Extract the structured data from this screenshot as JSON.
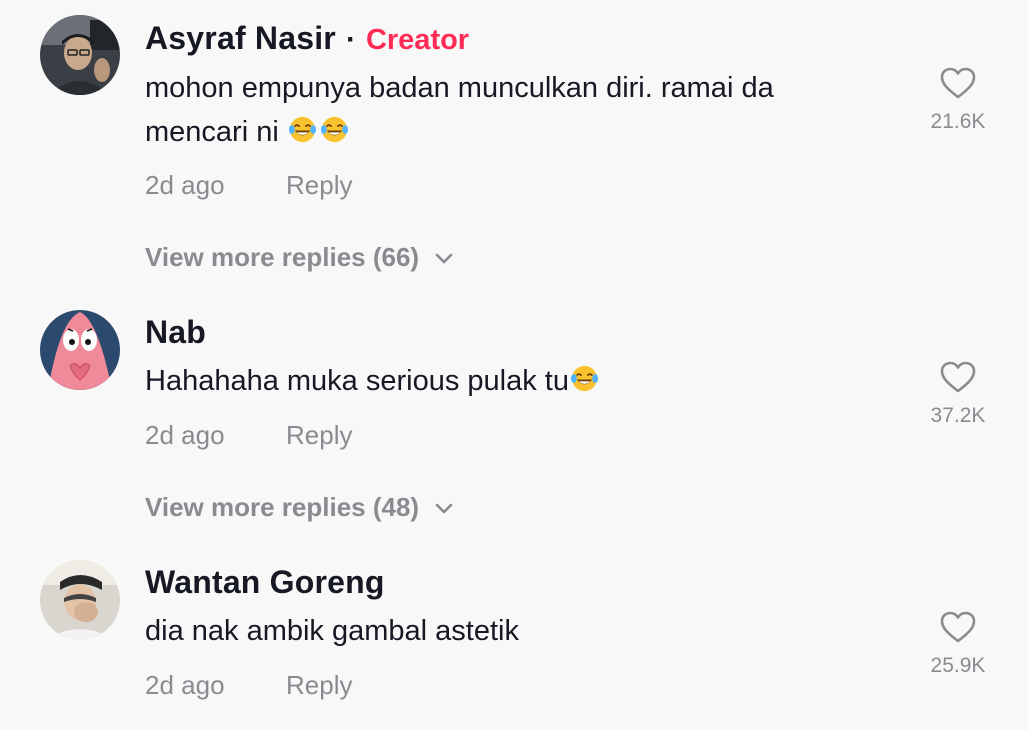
{
  "comments": [
    {
      "author": "Asyraf Nasir",
      "separator": "·",
      "badge": "Creator",
      "text_line1": "mohon empunya badan munculkan diri. ramai da",
      "text_line2": "mencari ni ",
      "emojis": [
        "face-with-tears-of-joy",
        "face-with-tears-of-joy"
      ],
      "time": "2d ago",
      "reply_label": "Reply",
      "likes": "21.6K",
      "more_replies": "View more replies (66)"
    },
    {
      "author": "Nab",
      "text_line1": "Hahahaha muka serious pulak tu",
      "emojis": [
        "face-with-tears-of-joy"
      ],
      "time": "2d ago",
      "reply_label": "Reply",
      "likes": "37.2K",
      "more_replies": "View more replies (48)"
    },
    {
      "author": "Wantan Goreng",
      "text_line1": "dia nak ambik gambal astetik",
      "time": "2d ago",
      "reply_label": "Reply",
      "likes": "25.9K"
    }
  ],
  "colors": {
    "background": "#f8f8f8",
    "text_primary": "#161823",
    "text_secondary": "#8a8b91",
    "creator_badge": "#fe2c55"
  },
  "icons": {
    "like": "heart-outline-icon",
    "expand": "chevron-down-icon"
  }
}
